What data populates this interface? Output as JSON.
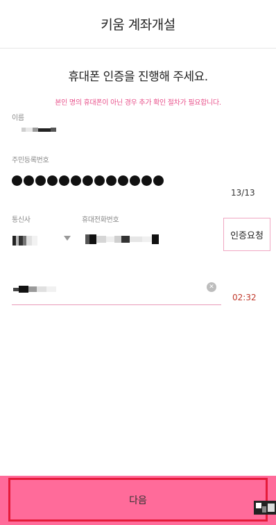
{
  "header": {
    "title": "키움 계좌개설"
  },
  "headline": "휴대폰 인증을 진행해 주세요.",
  "notice": "본인 명의 휴대폰이 아닌 경우 추가 확인 절차가 필요합니다.",
  "form": {
    "name": {
      "label": "이름",
      "value_masked": true
    },
    "rrn": {
      "label": "주민등록번호",
      "filled_digits": 13,
      "counter": "13/13"
    },
    "carrier": {
      "label": "통신사",
      "value_masked": true
    },
    "phone": {
      "label": "휴대전화번호",
      "value_masked": true
    },
    "auth_request_label": "인증요청",
    "code": {
      "value_masked": true,
      "timer": "02:32",
      "clear_icon": "close-circle-icon"
    }
  },
  "footer": {
    "next_label": "다음"
  },
  "colors": {
    "accent": "#ff6b9a",
    "notice": "#e8508a",
    "timer": "#c0392b",
    "frame": "#e51b3a"
  }
}
